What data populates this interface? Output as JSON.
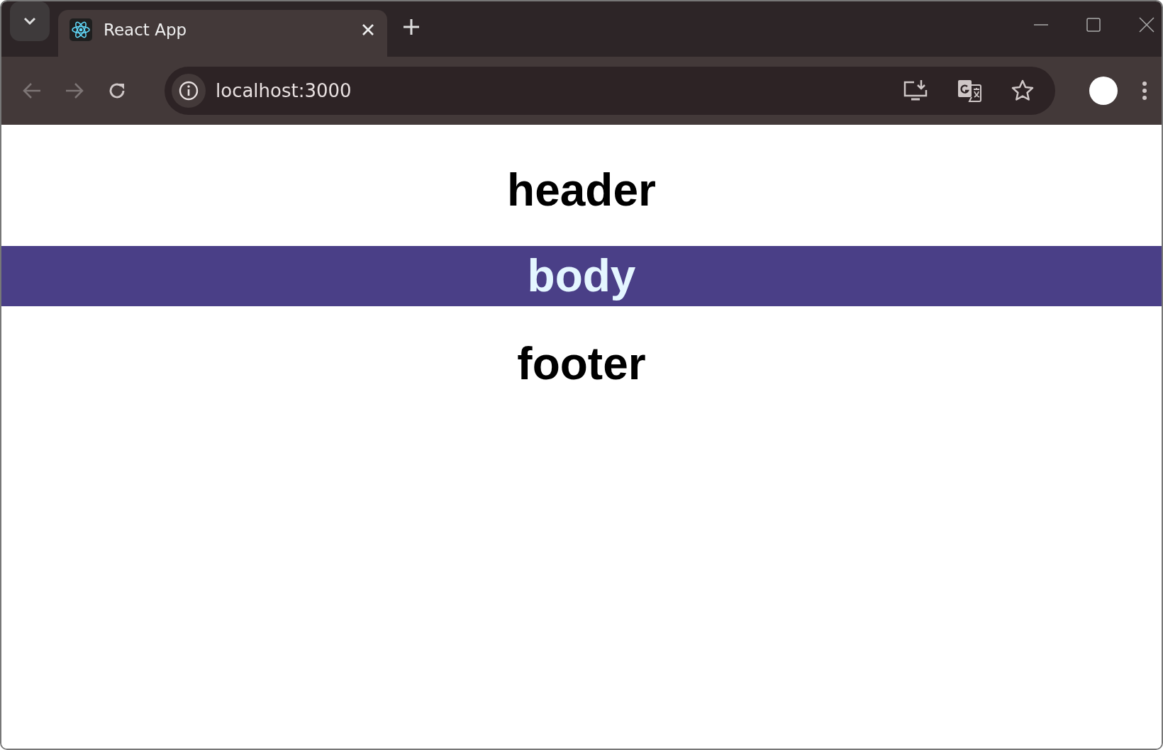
{
  "browser": {
    "tabs": [
      {
        "title": "React App",
        "selected": true
      }
    ],
    "address": "localhost:3000"
  },
  "page": {
    "header": "header",
    "body": "body",
    "footer": "footer"
  }
}
